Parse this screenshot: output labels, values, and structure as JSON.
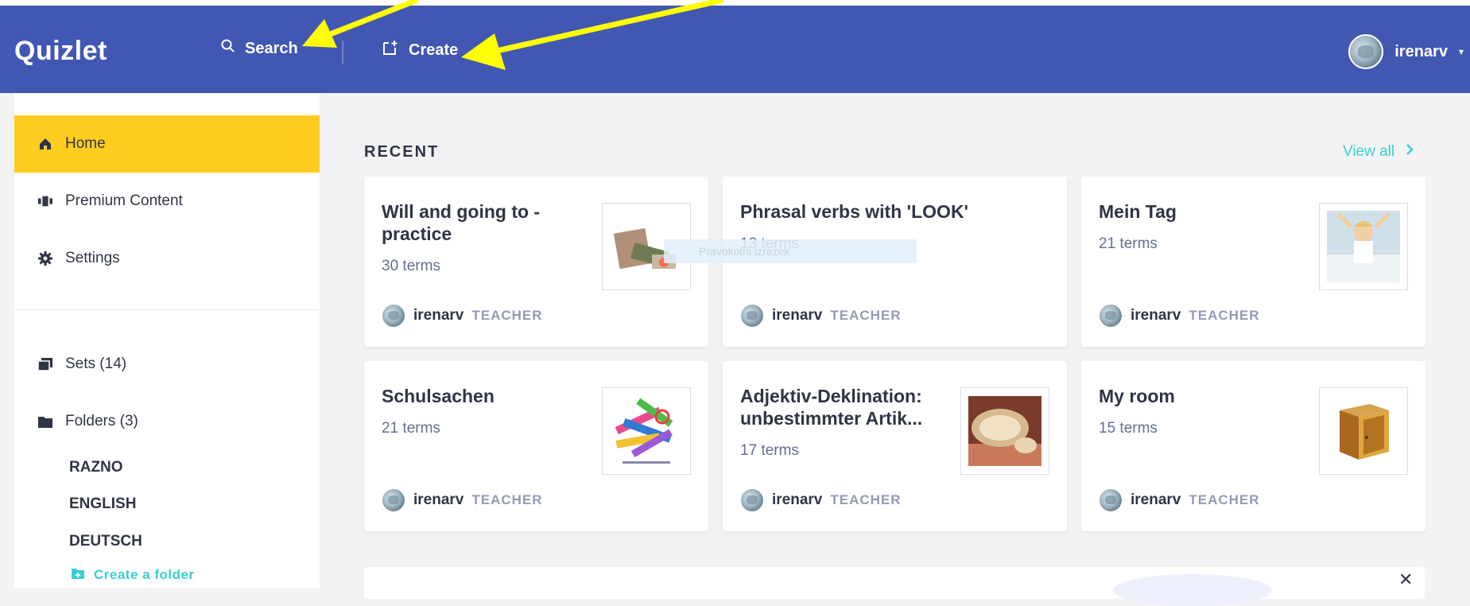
{
  "header": {
    "logo": "Quizlet",
    "search_label": "Search",
    "create_label": "Create",
    "username": "irenarv",
    "bg_color": "#4257b2"
  },
  "sidebar": {
    "items": [
      {
        "label": "Home",
        "icon": "home-icon",
        "active": true
      },
      {
        "label": "Premium Content",
        "icon": "premium-content-icon"
      },
      {
        "label": "Settings",
        "icon": "gear-icon"
      },
      {
        "label": "Sets (14)",
        "icon": "sets-icon"
      },
      {
        "label": "Folders (3)",
        "icon": "folder-icon"
      }
    ],
    "folders": [
      "RAZNO",
      "ENGLISH",
      "DEUTSCH"
    ],
    "create_folder": "Create a folder",
    "active_color": "#ffcd1f",
    "accent_color": "#3ccfcf"
  },
  "main": {
    "section_title": "RECENT",
    "view_all": "View all",
    "cards": [
      {
        "title": "Will and going to - practice",
        "terms": "30 terms",
        "author": "irenarv",
        "role": "TEACHER",
        "thumb": "money-photo"
      },
      {
        "title": "Phrasal verbs with 'LOOK'",
        "terms": "13 terms",
        "author": "irenarv",
        "role": "TEACHER"
      },
      {
        "title": "Mein Tag",
        "terms": "21 terms",
        "author": "irenarv",
        "role": "TEACHER",
        "thumb": "child-waking-photo"
      },
      {
        "title": "Schulsachen",
        "terms": "21 terms",
        "author": "irenarv",
        "role": "TEACHER",
        "thumb": "school-supplies-photo"
      },
      {
        "title": "Adjektiv-Deklination: unbestimmter Artik...",
        "terms": "17 terms",
        "author": "irenarv",
        "role": "TEACHER",
        "thumb": "bread-photo"
      },
      {
        "title": "My room",
        "terms": "15 terms",
        "author": "irenarv",
        "role": "TEACHER",
        "thumb": "cabinet-photo"
      }
    ],
    "tooltip": "Pravokotni izrezek"
  }
}
